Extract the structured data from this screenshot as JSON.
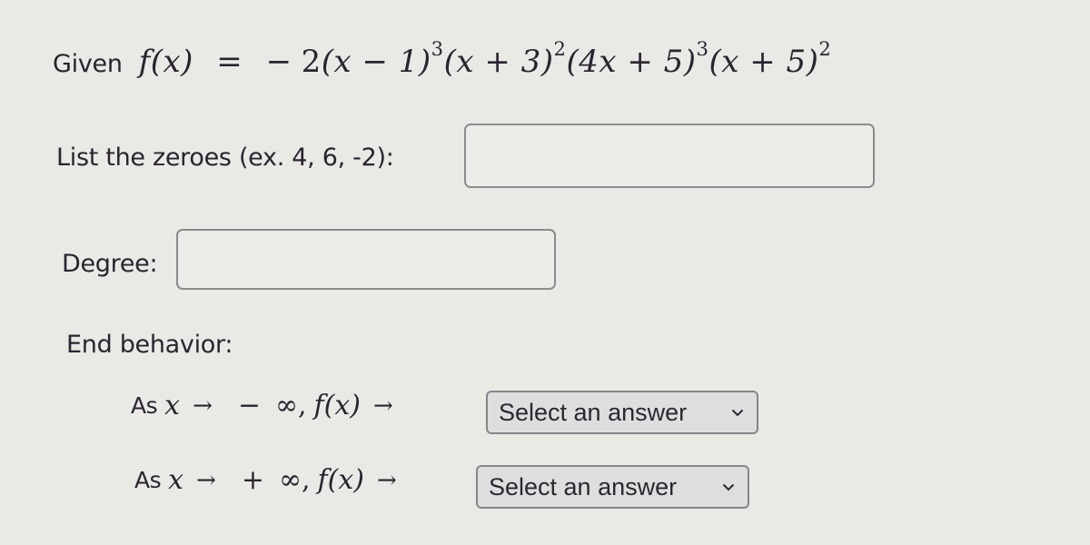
{
  "question": {
    "given_label": "Given",
    "function": {
      "lhs": "f(x)",
      "equals": "=",
      "leading_sign": "−",
      "coefficient": "2",
      "factors": [
        {
          "base": "(x − 1)",
          "exponent": "3"
        },
        {
          "base": "(x + 3)",
          "exponent": "2"
        },
        {
          "base": "(4x + 5)",
          "exponent": "3"
        },
        {
          "base": "(x + 5)",
          "exponent": "2"
        }
      ]
    }
  },
  "zeroes": {
    "label": "List the zeroes (ex. 4, 6, -2):",
    "value": "",
    "placeholder": ""
  },
  "degree": {
    "label": "Degree:",
    "value": "",
    "placeholder": ""
  },
  "end_behavior": {
    "label": "End behavior:",
    "rows": [
      {
        "as_word": "As",
        "var": "x",
        "arrow": "→",
        "sign": "−",
        "infinity": "∞,",
        "fx": "f(x)",
        "arrow2": "→",
        "select_label": "Select an answer"
      },
      {
        "as_word": "As",
        "var": "x",
        "arrow": "→",
        "sign": "+",
        "infinity": "∞,",
        "fx": "f(x)",
        "arrow2": "→",
        "select_label": "Select an answer"
      }
    ]
  },
  "icons": {
    "select_chevron": "chevron-down-icon"
  },
  "colors": {
    "background": "#e9e9e6",
    "input_border": "#8b8b8e",
    "select_background": "#dededf",
    "text": "#2a2430"
  }
}
